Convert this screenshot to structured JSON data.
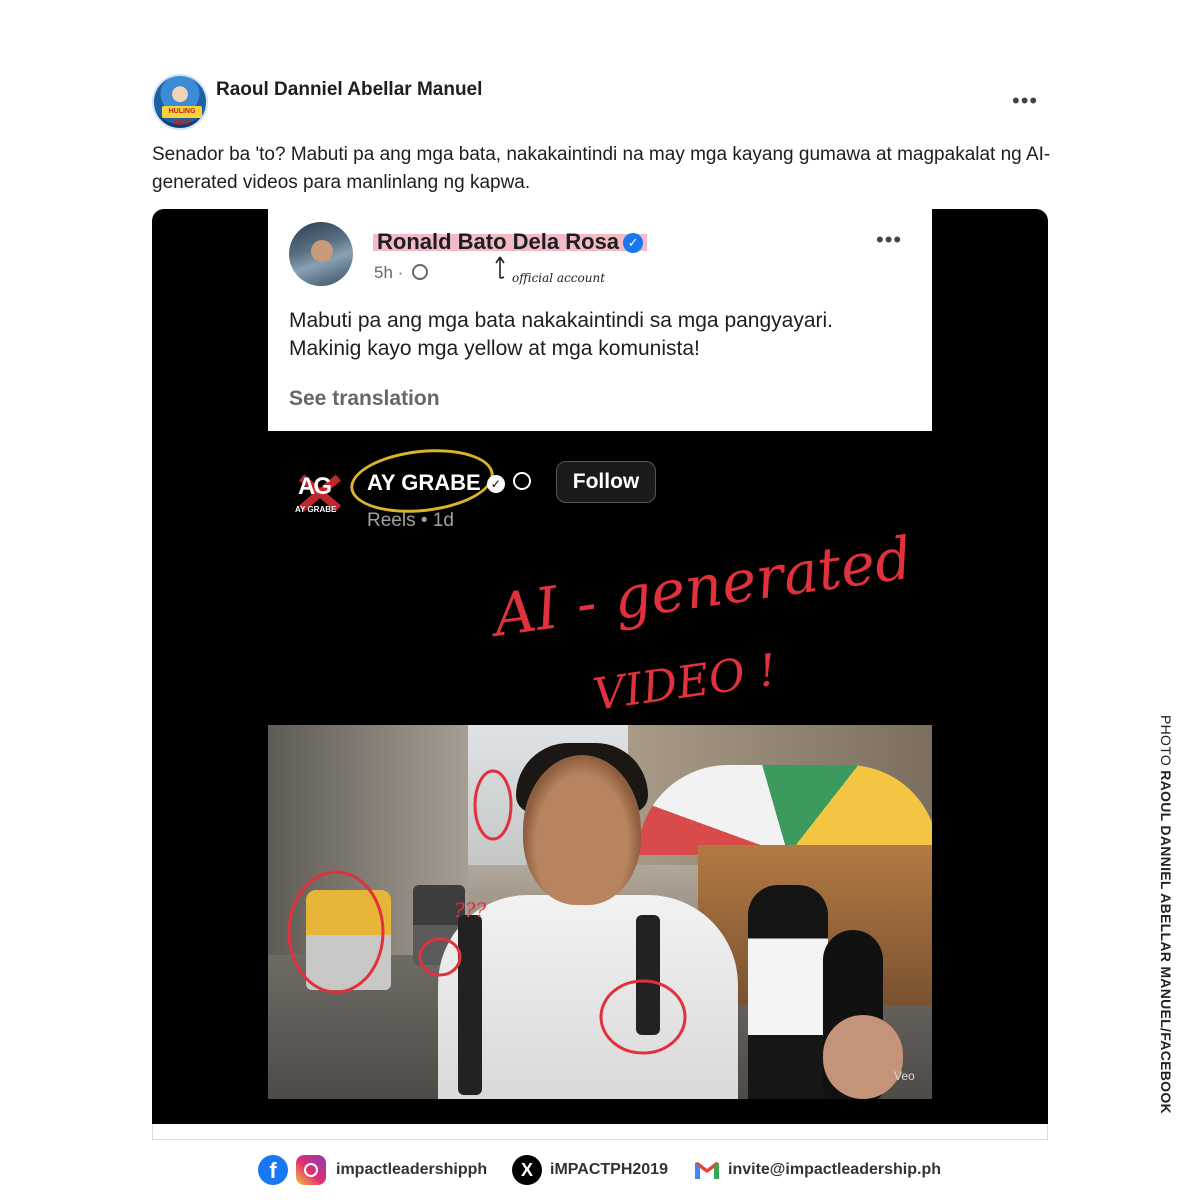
{
  "post": {
    "author": "Raoul Danniel Abellar Manuel",
    "more_menu": "•••",
    "caption": "Senador ba 'to? Mabuti pa ang mga bata, nakakaintindi na may mga kayang gumawa at magpakalat ng AI-generated videos para manlinlang ng kapwa.",
    "avatar_badge": "HULING HIRIT"
  },
  "screenshot": {
    "inner_post": {
      "author": "Ronald Bato Dela Rosa",
      "verified_icon": "verified-badge-icon",
      "time": "5h",
      "visibility_icon": "globe-icon",
      "annotation": "official account",
      "text_line1": "Mabuti pa ang mga bata nakakaintindi sa mga pangyayari.",
      "text_line2": "Makinig kayo mga yellow at mga komunista!",
      "see_translation": "See translation",
      "more_menu": "•••"
    },
    "reel": {
      "logo_text": "AG",
      "logo_sub": "AY GRABE",
      "page_name": "AY GRABE",
      "follow_label": "Follow",
      "meta": "Reels • 1d",
      "annotation_line1": "AI - generated",
      "annotation_line2": "VIDEO !",
      "video_watermark": "Veo",
      "video_annotations": "???"
    }
  },
  "credit": {
    "prefix": "PHOTO ",
    "name": "RAOUL DANNIEL ABELLAR MANUEL/FACEBOOK"
  },
  "footer": {
    "facebook_icon": "facebook-icon",
    "instagram_icon": "instagram-icon",
    "handle_fb_ig": "impactleadershipph",
    "x_icon": "x-icon",
    "handle_x": "iMPACTPH2019",
    "gmail_icon": "gmail-icon",
    "email": "invite@impactleadership.ph"
  },
  "colors": {
    "facebook_blue": "#1877f2",
    "annotation_red": "#e0313c",
    "annotation_yellow": "#d9b52a",
    "highlight_pink": "#ec8296",
    "media_background": "#000000"
  }
}
